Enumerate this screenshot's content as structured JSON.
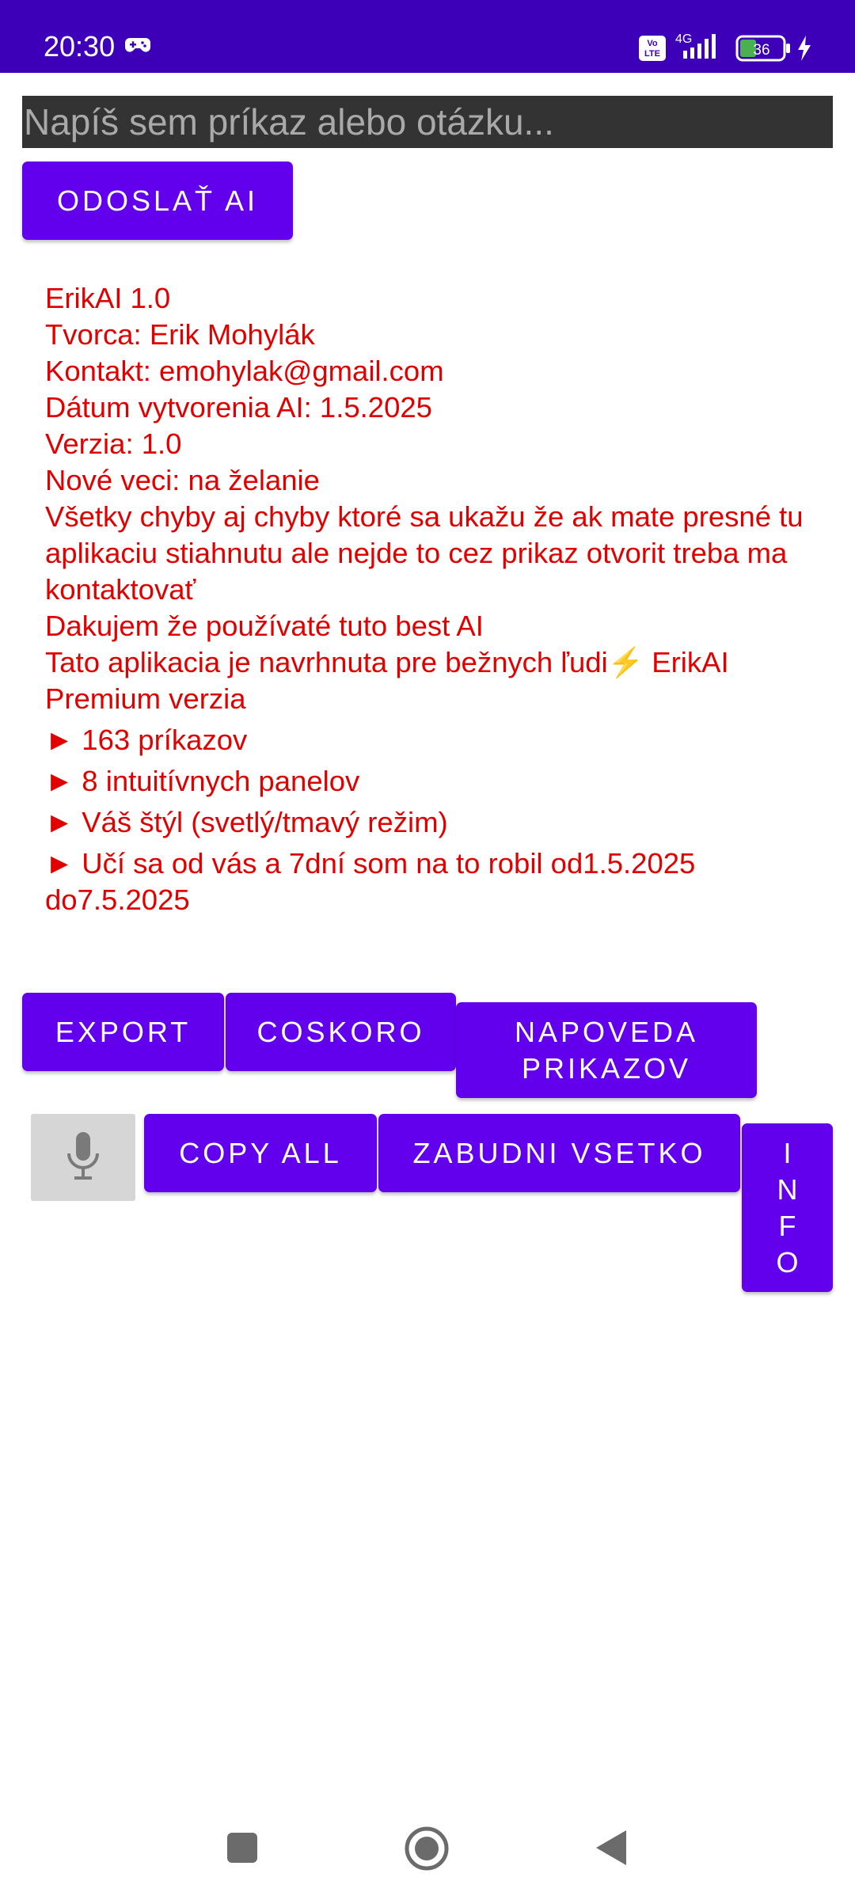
{
  "status_bar": {
    "time": "20:30",
    "network": "4G",
    "volte": "Vo LTE",
    "battery": "36",
    "background_color": "#3d00b8"
  },
  "command": {
    "placeholder": "Napíš sem príkaz alebo otázku...",
    "value": ""
  },
  "buttons": {
    "send": "ODOSLAŤ AI",
    "export": "EXPORT",
    "coskoro": "COSKORO",
    "napoveda": "NAPOVEDA PRIKAZOV",
    "copy_all": "COPY ALL",
    "zabudni": "ZABUDNI VSETKO",
    "info_letters": [
      "I",
      "N",
      "F",
      "O"
    ],
    "accent_color": "#6200ee"
  },
  "info": {
    "text_color": "#e00000",
    "lines": [
      "ErikAI 1.0",
      "Tvorca: Erik Mohylák",
      "Kontakt: emohylak@gmail.com",
      "Dátum vytvorenia AI: 1.5.2025",
      "Verzia: 1.0",
      "Nové veci: na želanie",
      "Všetky chyby aj chyby ktoré sa ukažu že ak mate presné tu aplikaciu stiahnutu ale nejde to cez prikaz otvorit treba ma kontaktovať",
      "Dakujem že používaté tuto best AI"
    ],
    "designed_for": "Tato aplikacia je navrhnuta pre bežnych ľudi",
    "bolt_icon": "⚡",
    "premium": " ErikAI Premium verzia",
    "features": [
      "► 163 príkazov",
      "► 8 intuitívnych panelov",
      "► Váš štýl (svetlý/tmavý režim)",
      "► Učí sa od vás a 7dní som na to robil od1.5.2025 do7.5.2025"
    ]
  },
  "icons": {
    "status": [
      "gamepad-icon",
      "volte-icon",
      "signal-icon",
      "battery-icon",
      "charging-icon"
    ],
    "mic": "microphone-icon",
    "nav": [
      "recents-square-icon",
      "home-circle-icon",
      "back-triangle-icon"
    ]
  }
}
